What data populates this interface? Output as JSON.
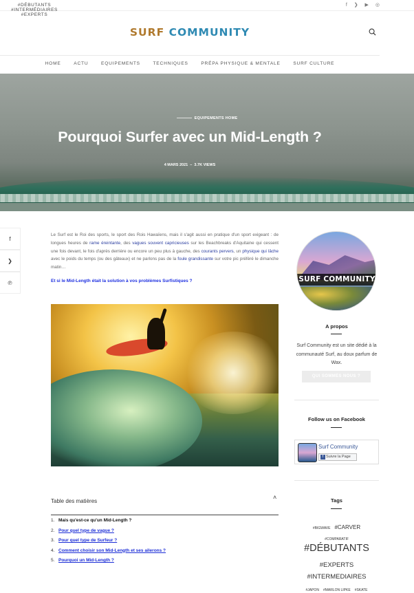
{
  "topbar": {
    "tags": [
      "#DÉBUTANTS",
      "#INTERMÉDIAIRES",
      "#EXPERTS"
    ],
    "social": [
      "facebook-icon",
      "twitter-icon",
      "youtube-icon",
      "instagram-icon"
    ]
  },
  "header": {
    "logo_part1": "SURF ",
    "logo_part2": "COMMUNITY"
  },
  "nav": [
    "HOME",
    "ACTU",
    "EQUIPEMENTS",
    "TECHNIQUES",
    "PRÉPA PHYSIQUE & MENTALE",
    "SURF CULTURE"
  ],
  "hero": {
    "categories": "EQUIPEMENTS   HOME",
    "title": "Pourquoi Surfer avec un Mid-Length ?",
    "date": "4 MARS 2021",
    "separator": "–",
    "views": "3.7K VIEWS"
  },
  "share": [
    "facebook-icon",
    "twitter-icon",
    "pinterest-icon"
  ],
  "article": {
    "intro_parts": [
      {
        "t": "Le Surf est le Roi des sports, le sport des Rois Hawaïens, mais il s'agit aussi en pratique d'un sport exigeant : de longues heures de ",
        "hl": false
      },
      {
        "t": "rame éreintante",
        "hl": true
      },
      {
        "t": ", des ",
        "hl": false
      },
      {
        "t": "vagues souvent capricieuses",
        "hl": true
      },
      {
        "t": " sur les Beachbreaks d'Aquitaine qui cessent une fois devant, le fois d'après derrière ou encore un peu plus à gauche, des ",
        "hl": false
      },
      {
        "t": "courants pervers",
        "hl": true
      },
      {
        "t": ", un ",
        "hl": false
      },
      {
        "t": "physique qui lâche",
        "hl": true
      },
      {
        "t": " avec le poids du temps (ou des gâteaux) et ne parlons pas de la ",
        "hl": false
      },
      {
        "t": "foule grandissante",
        "hl": true
      },
      {
        "t": " sur votre pic préféré le dimanche matin…",
        "hl": false
      }
    ],
    "lead": "Et si le Mid-Length était la solution à vos problèmes Surfistiques ?"
  },
  "toc": {
    "title": "Table des matières",
    "items": [
      {
        "n": "1.",
        "label": "Mais qu'est-ce qu'un Mid-Length ?",
        "link": false
      },
      {
        "n": "2.",
        "label": "Pour quel type de vague ?",
        "link": true
      },
      {
        "n": "3.",
        "label": "Pour quel type de Surfeur ?",
        "link": true
      },
      {
        "n": "4.",
        "label": "Comment choisir son Mid-Length et ses ailerons ?",
        "link": true
      },
      {
        "n": "5.",
        "label": "Pourquoi un Mid-Length ?",
        "link": true
      }
    ]
  },
  "sidebar": {
    "avatar_text": "SURF COMMUNITY",
    "about_title": "A propos",
    "about_text": "Surf Community est un site dédié à la communauté Surf, au doux parfum de Wax.",
    "about_button": "QUI SOMMES NOUS ?",
    "facebook_title": "Follow us on Facebook",
    "fb_page_name": "Surf Community",
    "fb_like": "Suivre la Page",
    "tags_title": "Tags",
    "tag_rows": [
      [
        {
          "t": "#BIGWAVE",
          "s": 5
        },
        {
          "t": "#CARVER",
          "s": 8
        }
      ],
      [
        {
          "t": "#COMPARATIF",
          "s": 5
        }
      ],
      [
        {
          "t": "#DÉBUTANTS",
          "s": 14.5
        }
      ],
      [
        {
          "t": "#EXPERTS",
          "s": 9.5
        }
      ],
      [
        {
          "t": "#INTERMEDIAIRES",
          "s": 9.5
        }
      ],
      [
        {
          "t": "#JAPON",
          "s": 5
        },
        {
          "t": "#MARLON LIPKE",
          "s": 5
        },
        {
          "t": "#SKATE",
          "s": 5
        }
      ]
    ]
  }
}
